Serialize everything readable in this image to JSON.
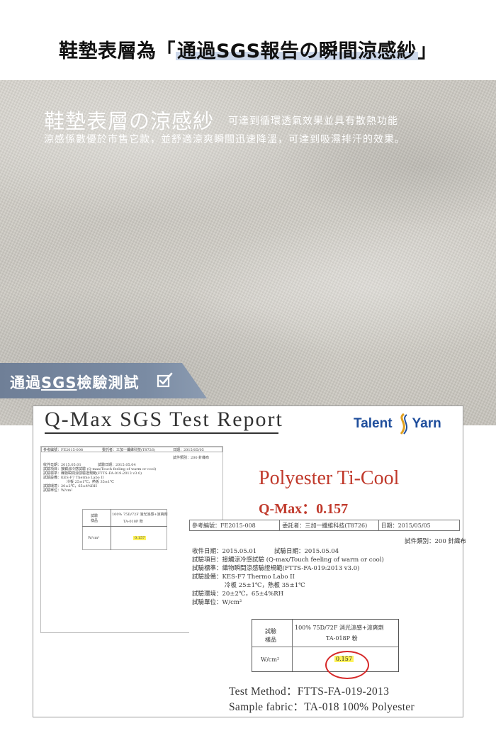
{
  "headline": {
    "prefix": "鞋墊表層為「",
    "highlight": "通過SGS報告の瞬間涼感紗",
    "suffix": "」"
  },
  "fabric": {
    "title": "鞋墊表層の涼感紗",
    "subtitle": "可達到循環透氣效果並具有散熱功能",
    "description": "涼感係數優於市售它款，並舒適涼爽瞬間迅速降溫，可達到吸濕排汗的效果。"
  },
  "badge": {
    "prefix": "通過",
    "sgs": "SGS",
    "suffix": "檢驗測試",
    "icon": "checkbox-check-icon"
  },
  "report": {
    "title": "Q-Max SGS Test Report",
    "logo_left": "Talent",
    "logo_right": "Yarn",
    "product": "Polyester Ti-Cool",
    "qmax": "Q-Max：0.157",
    "doc": {
      "ref_no": "參考編號：FE2015-008",
      "client": "委託者：三加一纖維科技(T8726)",
      "date": "日期：2015/05/05",
      "category": "試件類別：200 針織布",
      "received": "收件日期：2015.05.01",
      "tested": "試驗日期：2015.05.04",
      "item": "試驗項目：接觸涼冷感試驗 (Q-max/Touch feeling of warm or cool)",
      "standard": "試驗標準：織物瞬間涼感驗證規範(FTTS-FA-019:2013 v3.0)",
      "equipment": "試驗設備：KES-F7 Thermo Labo II",
      "plates": "冷板 25±1℃，熱板 35±1℃",
      "environment": "試驗環境：20±2℃，65±4%RH",
      "unit": "試驗單位：W/cm²",
      "sample_label_1": "試驗",
      "sample_label_2": "樣品",
      "sample_name": "100% 75D/72F 消光涼感+涼爽劑",
      "sample_code": "TA-018P 粉",
      "row_label": "W/cm²",
      "row_value": "0.157"
    },
    "method": "Test Method：FTTS-FA-019-2013",
    "sample_fabric": "Sample fabric：TA-018 100% Polyester"
  },
  "colors": {
    "badge": "#7a8ba3",
    "accent_red": "#c0392b",
    "logo_blue": "#1f4e9c",
    "highlight": "#fff35a"
  }
}
